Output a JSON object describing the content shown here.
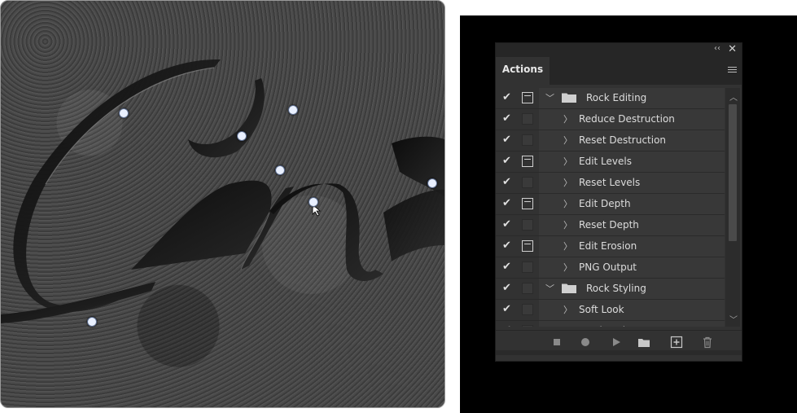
{
  "panel": {
    "tab_label": "Actions",
    "collapse_glyph": "‹‹",
    "close_glyph": "✕"
  },
  "actions": {
    "rows": [
      {
        "label": "Rock Editing",
        "type": "set",
        "checked": true,
        "dialog": true,
        "expanded": true
      },
      {
        "label": "Reduce Destruction",
        "type": "action",
        "checked": true,
        "dialog": false
      },
      {
        "label": "Reset Destruction",
        "type": "action",
        "checked": true,
        "dialog": false
      },
      {
        "label": "Edit Levels",
        "type": "action",
        "checked": true,
        "dialog": true
      },
      {
        "label": "Reset Levels",
        "type": "action",
        "checked": true,
        "dialog": false
      },
      {
        "label": "Edit Depth",
        "type": "action",
        "checked": true,
        "dialog": true
      },
      {
        "label": "Reset Depth",
        "type": "action",
        "checked": true,
        "dialog": false
      },
      {
        "label": "Edit Erosion",
        "type": "action",
        "checked": true,
        "dialog": true
      },
      {
        "label": "PNG Output",
        "type": "action",
        "checked": true,
        "dialog": false
      },
      {
        "label": "Rock Styling",
        "type": "set",
        "checked": true,
        "dialog": false,
        "expanded": true
      },
      {
        "label": "Soft Look",
        "type": "action",
        "checked": true,
        "dialog": false
      },
      {
        "label": "Hard Look",
        "type": "action",
        "checked": true,
        "dialog": false
      }
    ]
  },
  "toolbar": {
    "buttons": [
      "stop-icon",
      "record-icon",
      "play-icon",
      "folder-icon",
      "new-action-icon",
      "trash-icon"
    ]
  },
  "colors": {
    "panel_bg": "#323232",
    "row_bg": "#383838",
    "text": "#dcdcdc",
    "handle": "#e9f0ff"
  }
}
